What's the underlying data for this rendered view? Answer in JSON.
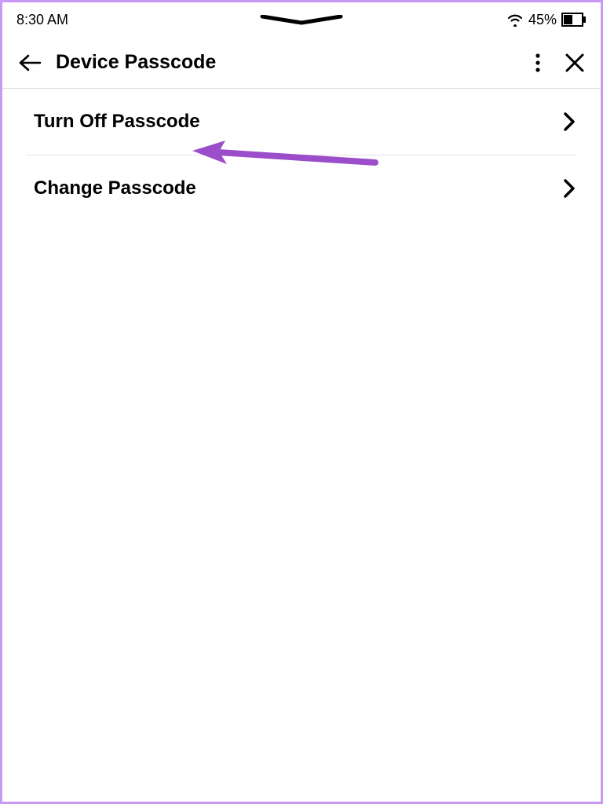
{
  "statusBar": {
    "time": "8:30 AM",
    "battery": "45%"
  },
  "header": {
    "title": "Device Passcode"
  },
  "items": [
    {
      "label": "Turn Off Passcode"
    },
    {
      "label": "Change Passcode"
    }
  ],
  "colors": {
    "annotation": "#9b4dca"
  }
}
